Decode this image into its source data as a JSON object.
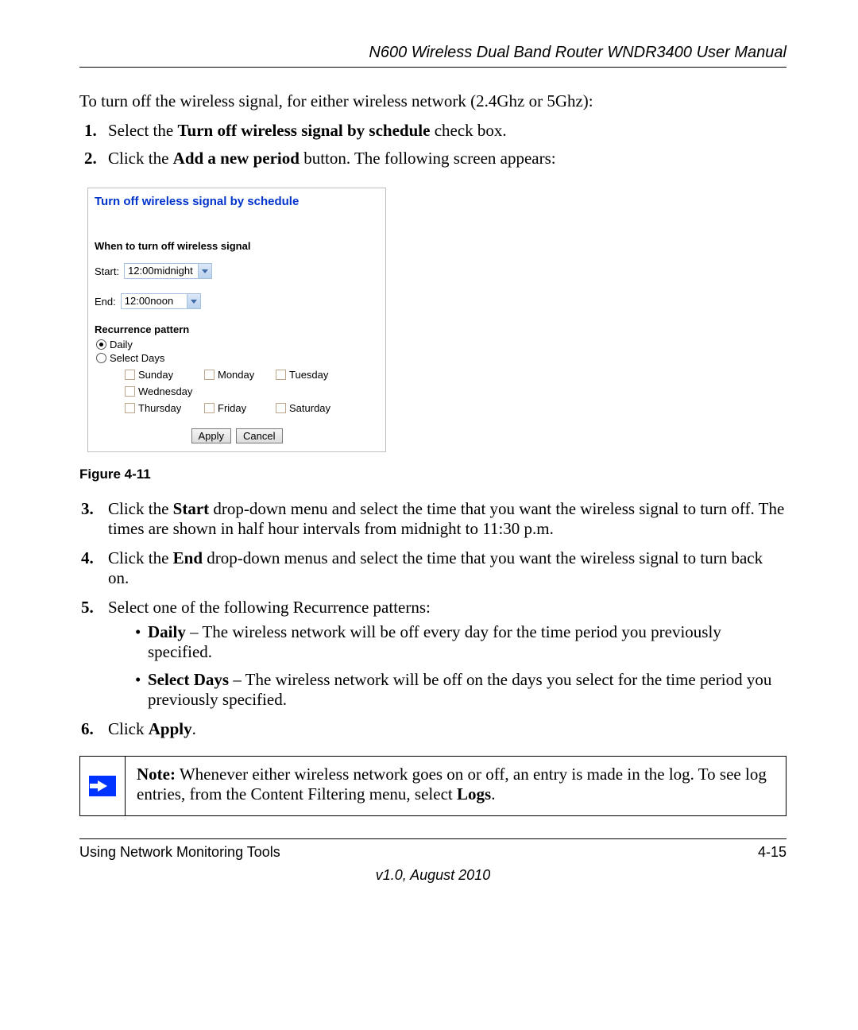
{
  "header": "N600 Wireless Dual Band Router WNDR3400 User Manual",
  "intro": "To turn off the wireless signal, for either wireless network (2.4Ghz or 5Ghz):",
  "steps_top": [
    {
      "pre": "Select the ",
      "bold": "Turn off wireless signal by schedule",
      "post": " check box."
    },
    {
      "pre": "Click the ",
      "bold": "Add a new period",
      "post": " button. The following screen appears:"
    }
  ],
  "screenshot": {
    "title": "Turn off wireless signal by schedule",
    "when_label": "When to turn off wireless signal",
    "start_label": "Start:",
    "start_value": "12:00midnight",
    "end_label": "End:",
    "end_value": "12:00noon",
    "recurrence_label": "Recurrence pattern",
    "daily": "Daily",
    "select_days": "Select Days",
    "days_row1": [
      "Sunday",
      "Monday",
      "Tuesday"
    ],
    "days_row2": [
      "Wednesday"
    ],
    "days_row3": [
      "Thursday",
      "Friday",
      "Saturday"
    ],
    "apply": "Apply",
    "cancel": "Cancel"
  },
  "figure_caption": "Figure 4-11",
  "step3_pre": "Click the ",
  "step3_bold": "Start",
  "step3_post": " drop-down menu and select the time that you want the wireless signal to turn off. The times are shown in half hour intervals from midnight to 11:30 p.m.",
  "step4_pre": "Click the ",
  "step4_bold": "End",
  "step4_post": " drop-down menus and select the time that you want the wireless signal to turn back on.",
  "step5": "Select one of the following Recurrence patterns:",
  "bullet1_bold": "Daily",
  "bullet1_tail": " – The wireless network will be off every day for the time period you previously specified.",
  "bullet2_bold": "Select Days",
  "bullet2_tail": " – The wireless network will be off on the days you select for the time period you previously specified.",
  "step6_pre": "Click ",
  "step6_bold": "Apply",
  "step6_post": ".",
  "note_bold": "Note:",
  "note_text1": " Whenever either wireless network goes on or off, an entry is made in the log. To see log entries, from the Content Filtering menu, select ",
  "note_bold2": "Logs",
  "note_text2": ".",
  "footer_left": "Using Network Monitoring Tools",
  "footer_right": "4-15",
  "footer_version": "v1.0, August 2010"
}
